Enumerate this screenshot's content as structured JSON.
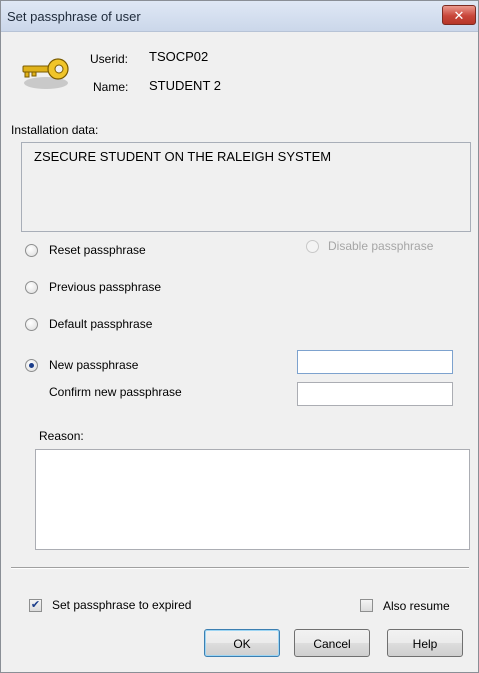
{
  "window": {
    "title": "Set passphrase of user",
    "close_icon": "close-icon"
  },
  "user": {
    "userid_label": "Userid:",
    "userid_value": "TSOCP02",
    "name_label": "Name:",
    "name_value": "STUDENT 2",
    "icon": "key-icon"
  },
  "installation": {
    "label": "Installation data:",
    "value": "ZSECURE STUDENT ON THE RALEIGH SYSTEM"
  },
  "options": {
    "reset_label": "Reset passphrase",
    "disable_label": "Disable passphrase",
    "previous_label": "Previous passphrase",
    "default_label": "Default passphrase",
    "new_label": "New passphrase",
    "confirm_label": "Confirm new passphrase",
    "selected": "new"
  },
  "reason": {
    "label": "Reason:"
  },
  "footer": {
    "expired_label": "Set passphrase to expired",
    "expired_checked": true,
    "resume_label": "Also resume",
    "resume_checked": false,
    "ok_label": "OK",
    "cancel_label": "Cancel",
    "help_label": "Help"
  },
  "colors": {
    "title_bar": "#cbd7ea",
    "close_button": "#c8463a",
    "dialog_background": "#f0f0f0"
  }
}
